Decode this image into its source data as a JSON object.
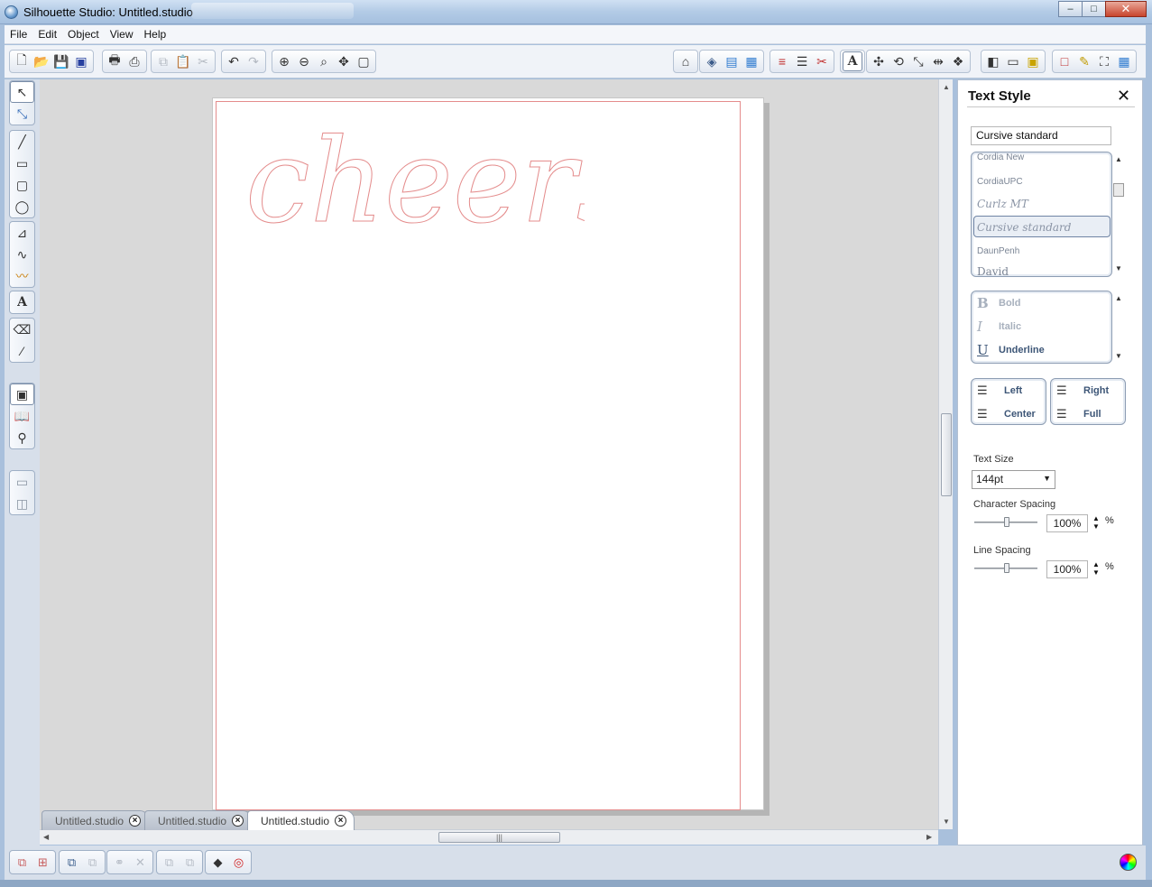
{
  "window": {
    "title": "Silhouette Studio: Untitled.studio",
    "controls": {
      "minimize": "–",
      "maximize": "□",
      "close": "✕"
    }
  },
  "menu": [
    "File",
    "Edit",
    "Object",
    "View",
    "Help"
  ],
  "toolbar_left": [
    {
      "icon": "new-document-icon",
      "glyph": "🗋"
    },
    {
      "icon": "open-folder-icon",
      "glyph": "📂"
    },
    {
      "icon": "save-icon",
      "glyph": "💾"
    },
    {
      "icon": "save-to-card-icon",
      "glyph": "▣"
    },
    {
      "icon": "print-icon",
      "glyph": "🖶"
    },
    {
      "icon": "print-cut-icon",
      "glyph": "⎙"
    },
    {
      "icon": "copy-icon",
      "glyph": "⧉"
    },
    {
      "icon": "paste-icon",
      "glyph": "📋"
    },
    {
      "icon": "cut-icon",
      "glyph": "✂"
    },
    {
      "icon": "undo-icon",
      "glyph": "↶"
    },
    {
      "icon": "redo-icon",
      "glyph": "↷"
    },
    {
      "icon": "zoom-in-icon",
      "glyph": "⊕"
    },
    {
      "icon": "zoom-out-icon",
      "glyph": "⊖"
    },
    {
      "icon": "zoom-select-icon",
      "glyph": "⌕"
    },
    {
      "icon": "pan-icon",
      "glyph": "✥"
    },
    {
      "icon": "fit-to-page-icon",
      "glyph": "▢"
    }
  ],
  "toolbar_right": [
    {
      "icon": "page-setup-icon",
      "glyph": "⌂"
    },
    {
      "icon": "fill-color-icon",
      "glyph": "◈"
    },
    {
      "icon": "fill-gradient-icon",
      "glyph": "▤"
    },
    {
      "icon": "fill-pattern-icon",
      "glyph": "▦"
    },
    {
      "icon": "line-color-icon",
      "glyph": "≡"
    },
    {
      "icon": "line-style-icon",
      "glyph": "☰"
    },
    {
      "icon": "cut-style-icon",
      "glyph": "✂"
    },
    {
      "icon": "text-style-icon",
      "glyph": "A"
    },
    {
      "icon": "transform-icon",
      "glyph": "✣"
    },
    {
      "icon": "rotate-icon",
      "glyph": "⟲"
    },
    {
      "icon": "scale-icon",
      "glyph": "⤡"
    },
    {
      "icon": "move-icon",
      "glyph": "⇹"
    },
    {
      "icon": "replicate-icon",
      "glyph": "❖"
    },
    {
      "icon": "library-icon",
      "glyph": "◧"
    },
    {
      "icon": "store-icon",
      "glyph": "▭"
    },
    {
      "icon": "send-to-cutter-icon",
      "glyph": "▣"
    },
    {
      "icon": "cut-settings-icon",
      "glyph": "□"
    },
    {
      "icon": "sketch-icon",
      "glyph": "✎"
    },
    {
      "icon": "fullscreen-icon",
      "glyph": "⛶"
    },
    {
      "icon": "grid-icon",
      "glyph": "▦"
    }
  ],
  "left_tools": [
    {
      "icon": "select-arrow-icon",
      "glyph": "↖"
    },
    {
      "icon": "edit-points-icon",
      "glyph": "⤡"
    },
    {
      "icon": "line-tool-icon",
      "glyph": "╱"
    },
    {
      "icon": "rectangle-tool-icon",
      "glyph": "▭"
    },
    {
      "icon": "rounded-rectangle-icon",
      "glyph": "▢"
    },
    {
      "icon": "ellipse-tool-icon",
      "glyph": "◯"
    },
    {
      "icon": "polygon-tool-icon",
      "glyph": "⊿"
    },
    {
      "icon": "curve-tool-icon",
      "glyph": "∿"
    },
    {
      "icon": "freehand-tool-icon",
      "glyph": "〰"
    },
    {
      "icon": "text-tool-icon",
      "glyph": "A"
    },
    {
      "icon": "eraser-tool-icon",
      "glyph": "⌫"
    },
    {
      "icon": "knife-tool-icon",
      "glyph": "⁄"
    },
    {
      "icon": "page-view-icon",
      "glyph": "▣"
    },
    {
      "icon": "library-view-icon",
      "glyph": "📖"
    },
    {
      "icon": "store-view-icon",
      "glyph": "⚲"
    },
    {
      "icon": "split-horizontal-icon",
      "glyph": "▭"
    },
    {
      "icon": "split-vertical-icon",
      "glyph": "◫"
    }
  ],
  "canvas": {
    "text_object": "cheers"
  },
  "doc_tabs": [
    "Untitled.studio",
    "Untitled.studio",
    "Untitled.studio"
  ],
  "text_style_panel": {
    "title": "Text Style",
    "font_input": "Cursive standard",
    "fonts": [
      "Cordia New",
      "CordiaUPC",
      "Curlz MT",
      "Cursive standard",
      "DaunPenh",
      "David"
    ],
    "selected_font": "Cursive standard",
    "styles": [
      {
        "glyph": "B",
        "label": "Bold",
        "enabled": false
      },
      {
        "glyph": "I",
        "label": "Italic",
        "enabled": false
      },
      {
        "glyph": "U",
        "label": "Underline",
        "enabled": true
      }
    ],
    "align": {
      "left": "Left",
      "center": "Center",
      "right": "Right",
      "full": "Full"
    },
    "text_size_label": "Text Size",
    "text_size_value": "144pt",
    "char_spacing_label": "Character Spacing",
    "char_spacing_value": "100%",
    "line_spacing_label": "Line Spacing",
    "line_spacing_value": "100%",
    "percent": "%"
  },
  "colors": {
    "cut_line": "#e48c8c",
    "canvas": "#d9d9d9",
    "chrome": "#a9c0dc"
  }
}
